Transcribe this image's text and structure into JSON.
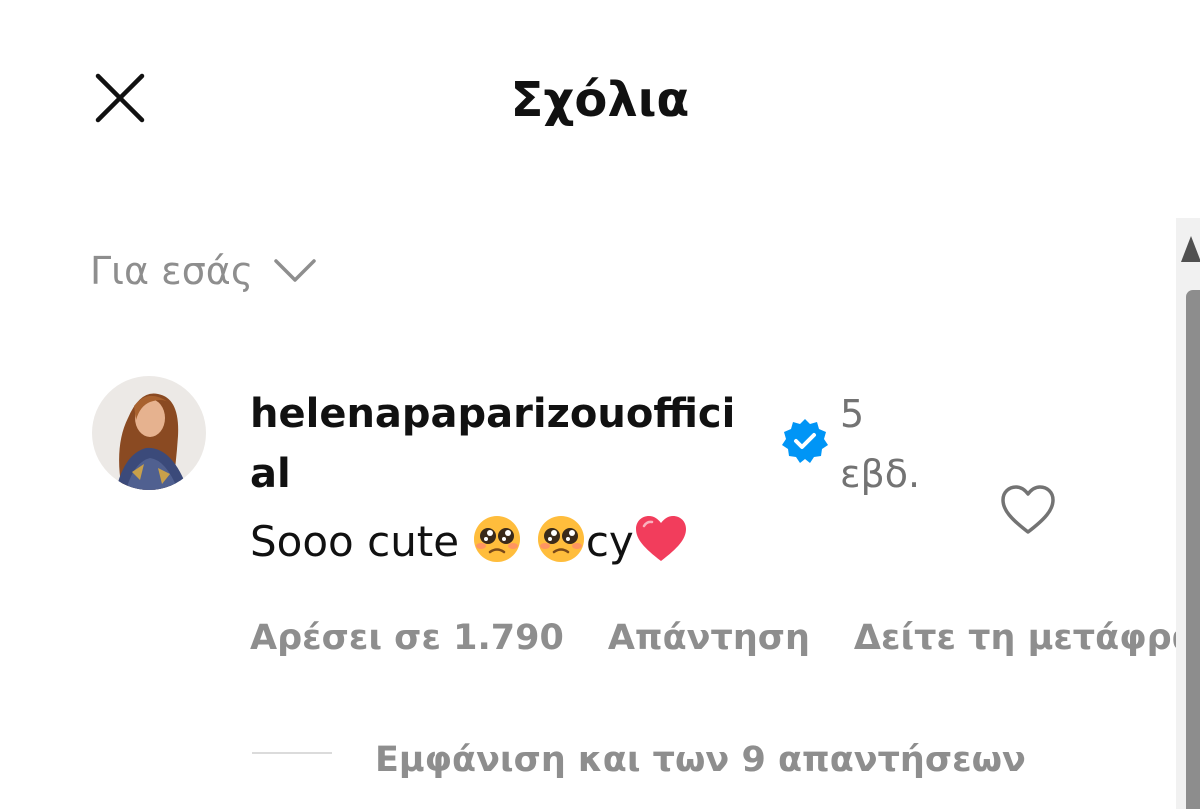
{
  "header": {
    "title": "Σχόλια",
    "close_icon": "close-icon"
  },
  "sort": {
    "label": "Για εσάς",
    "icon": "chevron-down-icon"
  },
  "comment": {
    "username": "helenapaparizouofficial",
    "verified": true,
    "verified_color": "#0095f6",
    "time": "5 εβδ.",
    "text_prefix": "Sooo cute",
    "text_middle": "cy",
    "emoji": [
      "pleading-face-emoji",
      "pleading-face-emoji",
      "red-heart-emoji"
    ],
    "likes_label": "Αρέσει σε 1.790",
    "reply_label": "Απάντηση",
    "translation_label": "Δείτε τη μετάφραση",
    "show_replies_label": "Εμφάνιση και των 9 απαντήσεων",
    "like_icon": "heart-outline-icon"
  }
}
